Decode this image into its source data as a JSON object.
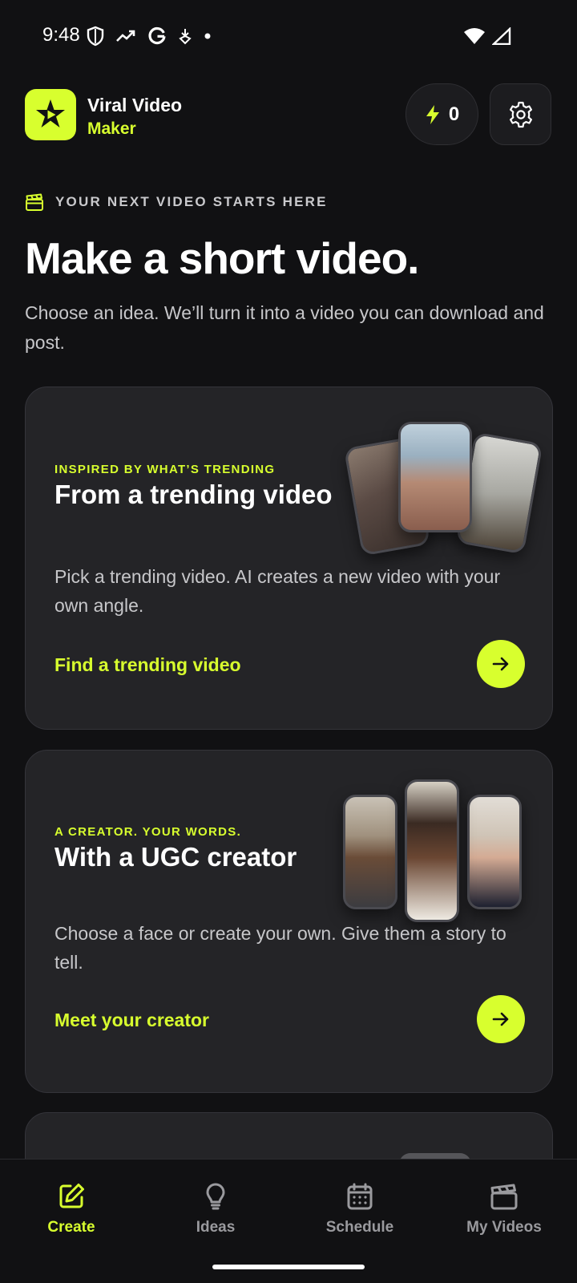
{
  "status_bar": {
    "time": "9:48"
  },
  "header": {
    "app_name_line1": "Viral Video",
    "app_name_line2": "Maker",
    "credits": "0",
    "icons": [
      "logo-star-icon",
      "bolt-icon",
      "gear-icon"
    ]
  },
  "hero": {
    "eyebrow": "YOUR NEXT VIDEO STARTS HERE",
    "title": "Make a short video.",
    "subtitle": "Choose an idea. We’ll turn it into a video you can download and post."
  },
  "cards": [
    {
      "eyebrow": "INSPIRED BY WHAT’S TRENDING",
      "title": "From a trending video",
      "description": "Pick a trending video. AI creates a new video with your own angle.",
      "cta": "Find a trending video"
    },
    {
      "eyebrow": "A CREATOR. YOUR WORDS.",
      "title": "With a UGC creator",
      "description": "Choose a face or create your own. Give them a story to tell.",
      "cta": "Meet your creator"
    }
  ],
  "bottom_nav": {
    "items": [
      {
        "label": "Create",
        "icon": "edit-icon",
        "active": true
      },
      {
        "label": "Ideas",
        "icon": "lightbulb-icon",
        "active": false
      },
      {
        "label": "Schedule",
        "icon": "calendar-icon",
        "active": false
      },
      {
        "label": "My Videos",
        "icon": "clapperboard-icon",
        "active": false
      }
    ]
  },
  "colors": {
    "accent": "#d8ff2e",
    "background": "#111113",
    "card": "#242427"
  }
}
